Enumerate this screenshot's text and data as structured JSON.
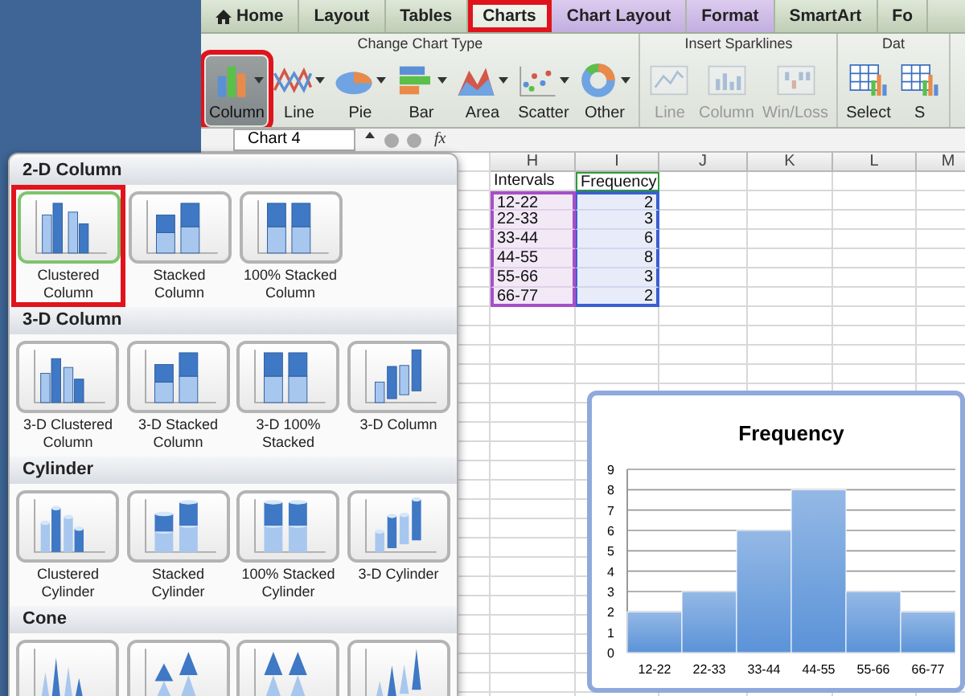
{
  "tabs": [
    {
      "label": "Home",
      "has_icon": true,
      "selected": false,
      "contextual": false,
      "highlighted": false
    },
    {
      "label": "Layout",
      "has_icon": false,
      "selected": false,
      "contextual": false,
      "highlighted": false
    },
    {
      "label": "Tables",
      "has_icon": false,
      "selected": false,
      "contextual": false,
      "highlighted": false
    },
    {
      "label": "Charts",
      "has_icon": false,
      "selected": true,
      "contextual": false,
      "highlighted": true
    },
    {
      "label": "Chart Layout",
      "has_icon": false,
      "selected": false,
      "contextual": true,
      "highlighted": false
    },
    {
      "label": "Format",
      "has_icon": false,
      "selected": false,
      "contextual": true,
      "highlighted": false
    },
    {
      "label": "SmartArt",
      "has_icon": false,
      "selected": false,
      "contextual": false,
      "highlighted": false
    },
    {
      "label": "Fo",
      "has_icon": false,
      "selected": false,
      "contextual": false,
      "highlighted": false
    }
  ],
  "ribbon_groups": [
    {
      "label": "Change Chart Type",
      "buttons": [
        {
          "label": "Column",
          "kind": "column",
          "dropdown": true,
          "pressed": true,
          "highlighted": true,
          "disabled": false
        },
        {
          "label": "Line",
          "kind": "line",
          "dropdown": true,
          "pressed": false,
          "highlighted": false,
          "disabled": false
        },
        {
          "label": "Pie",
          "kind": "pie",
          "dropdown": true,
          "pressed": false,
          "highlighted": false,
          "disabled": false
        },
        {
          "label": "Bar",
          "kind": "bar",
          "dropdown": true,
          "pressed": false,
          "highlighted": false,
          "disabled": false
        },
        {
          "label": "Area",
          "kind": "area",
          "dropdown": true,
          "pressed": false,
          "highlighted": false,
          "disabled": false
        },
        {
          "label": "Scatter",
          "kind": "scatter",
          "dropdown": true,
          "pressed": false,
          "highlighted": false,
          "disabled": false
        },
        {
          "label": "Other",
          "kind": "other",
          "dropdown": true,
          "pressed": false,
          "highlighted": false,
          "disabled": false
        }
      ]
    },
    {
      "label": "Insert Sparklines",
      "buttons": [
        {
          "label": "Line",
          "kind": "sparkline",
          "dropdown": false,
          "pressed": false,
          "highlighted": false,
          "disabled": true
        },
        {
          "label": "Column",
          "kind": "sparkcolumn",
          "dropdown": false,
          "pressed": false,
          "highlighted": false,
          "disabled": true
        },
        {
          "label": "Win/Loss",
          "kind": "winloss",
          "dropdown": false,
          "pressed": false,
          "highlighted": false,
          "disabled": true
        }
      ]
    },
    {
      "label": "Dat",
      "buttons": [
        {
          "label": "Select",
          "kind": "select",
          "dropdown": false,
          "pressed": false,
          "highlighted": false,
          "disabled": false
        },
        {
          "label": "S",
          "kind": "select",
          "dropdown": false,
          "pressed": false,
          "highlighted": false,
          "disabled": false
        }
      ]
    }
  ],
  "formula_bar": {
    "name_box": "Chart 4",
    "fx": "fx"
  },
  "sheet": {
    "columns": [
      "H",
      "I",
      "J",
      "K",
      "L",
      "M"
    ],
    "rows": [
      {
        "cells": [
          "Intervals",
          "Frequency"
        ],
        "in_range": false
      },
      {
        "cells": [
          "12-22",
          "2"
        ],
        "in_range": true
      },
      {
        "cells": [
          "22-33",
          "3"
        ],
        "in_range": true
      },
      {
        "cells": [
          "33-44",
          "6"
        ],
        "in_range": true
      },
      {
        "cells": [
          "44-55",
          "8"
        ],
        "in_range": true
      },
      {
        "cells": [
          "55-66",
          "3"
        ],
        "in_range": true
      },
      {
        "cells": [
          "66-77",
          "2"
        ],
        "in_range": true
      }
    ]
  },
  "gallery": {
    "sections": [
      {
        "title": "2-D Column",
        "kind": "column",
        "items": [
          {
            "label": "Clustered Column",
            "kind": "clustered",
            "selected": true,
            "highlighted": true
          },
          {
            "label": "Stacked Column",
            "kind": "stacked",
            "selected": false,
            "highlighted": false
          },
          {
            "label": "100% Stacked Column",
            "kind": "percent",
            "selected": false,
            "highlighted": false
          }
        ]
      },
      {
        "title": "3-D Column",
        "kind": "column",
        "items": [
          {
            "label": "3-D Clustered Column",
            "kind": "clustered3d",
            "selected": false,
            "highlighted": false
          },
          {
            "label": "3-D Stacked Column",
            "kind": "stacked",
            "selected": false,
            "highlighted": false
          },
          {
            "label": "3-D 100% Stacked",
            "kind": "percent",
            "selected": false,
            "highlighted": false
          },
          {
            "label": "3-D Column",
            "kind": "deep",
            "selected": false,
            "highlighted": false
          }
        ]
      },
      {
        "title": "Cylinder",
        "kind": "cylinder",
        "items": [
          {
            "label": "Clustered Cylinder",
            "kind": "clustered3d",
            "selected": false,
            "highlighted": false
          },
          {
            "label": "Stacked Cylinder",
            "kind": "stacked",
            "selected": false,
            "highlighted": false
          },
          {
            "label": "100% Stacked Cylinder",
            "kind": "percent",
            "selected": false,
            "highlighted": false
          },
          {
            "label": "3-D Cylinder",
            "kind": "deep",
            "selected": false,
            "highlighted": false
          }
        ]
      },
      {
        "title": "Cone",
        "kind": "cone",
        "items": [
          {
            "kind": "clustered3d",
            "selected": false,
            "highlighted": false
          },
          {
            "kind": "stacked",
            "selected": false,
            "highlighted": false
          },
          {
            "kind": "percent",
            "selected": false,
            "highlighted": false
          },
          {
            "kind": "deep",
            "selected": false,
            "highlighted": false
          }
        ]
      }
    ]
  },
  "chart": {
    "chart_data": {
      "type": "bar",
      "title": "Frequency",
      "categories": [
        "12-22",
        "22-33",
        "33-44",
        "44-55",
        "55-66",
        "66-77"
      ],
      "series": [
        {
          "color": "#5b93d8",
          "values": [
            2,
            3,
            6,
            8,
            3,
            2
          ]
        }
      ],
      "ylim": [
        0,
        9
      ],
      "yticks": [
        0,
        1,
        2,
        3,
        4,
        5,
        6,
        7,
        8,
        9
      ],
      "grid": true
    }
  }
}
